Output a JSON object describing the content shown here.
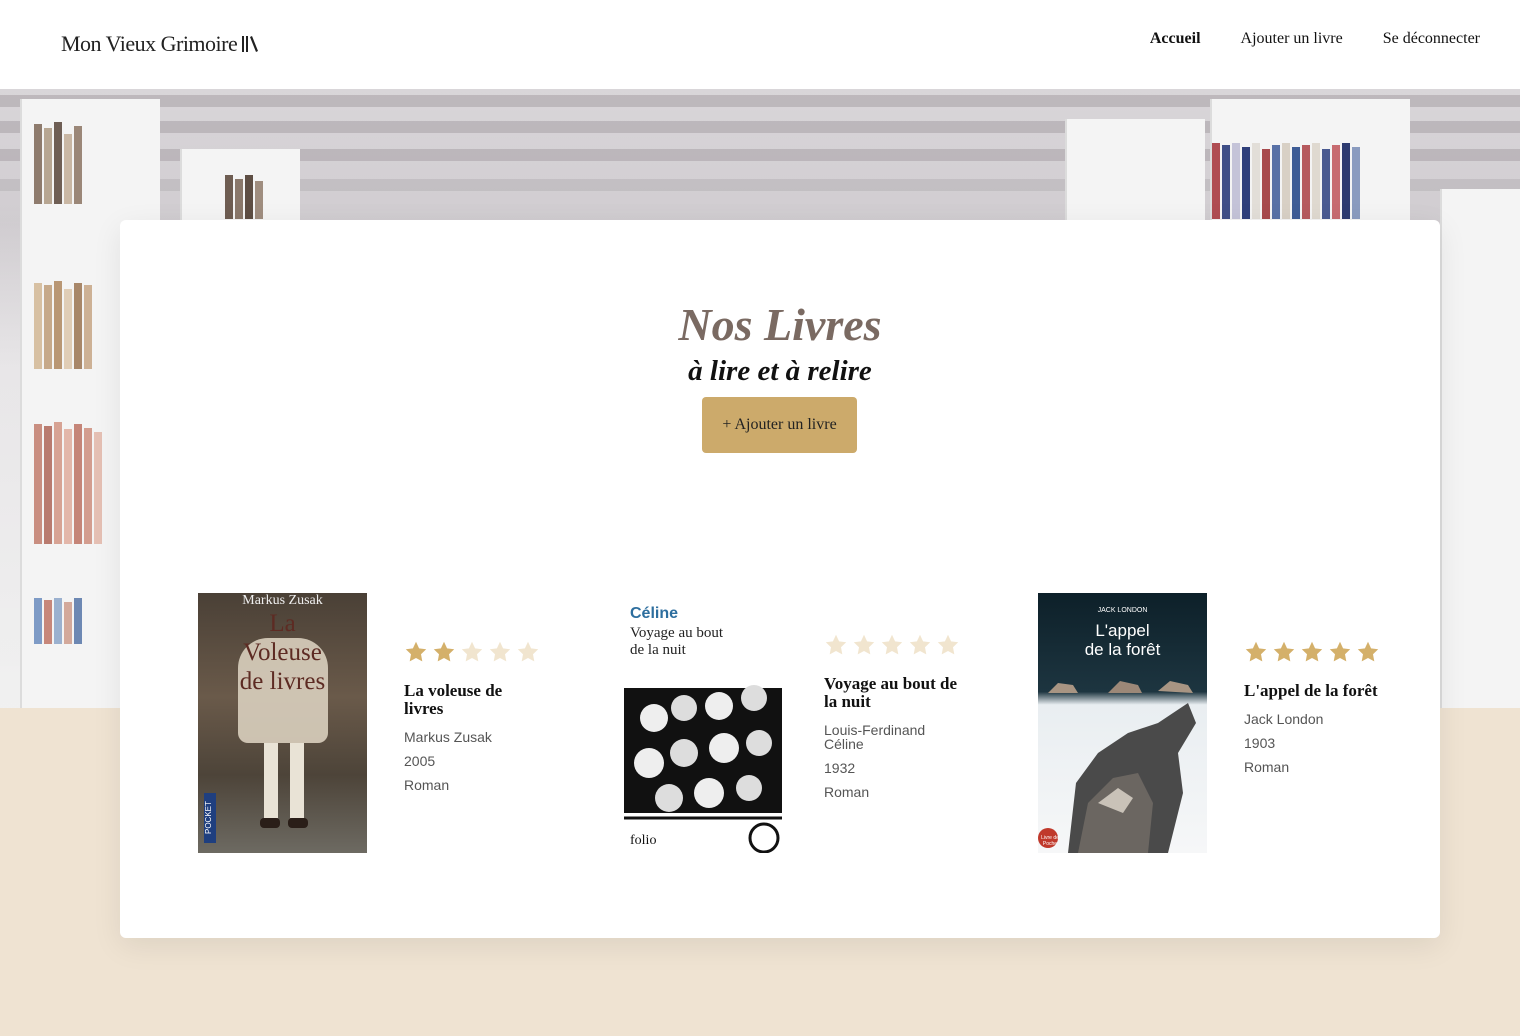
{
  "brand": {
    "name": "Mon Vieux Grimoire",
    "logo_icon": "books-icon"
  },
  "nav": [
    {
      "label": "Accueil",
      "active": true
    },
    {
      "label": "Ajouter un livre",
      "active": false
    },
    {
      "label": "Se déconnecter",
      "active": false
    }
  ],
  "hero": {
    "title": "Nos Livres",
    "subtitle": "à lire et à relire",
    "add_button": "+ Ajouter un livre"
  },
  "colors": {
    "accent": "#ccaa6b",
    "star_filled": "#d4b06a",
    "star_empty": "#f1e5cf",
    "page_bg": "#efe3d2"
  },
  "books": [
    {
      "title": "La voleuse de livres",
      "author": "Markus Zusak",
      "year": "2005",
      "genre": "Roman",
      "rating": 2,
      "cover": {
        "author": "Markus Zusak",
        "title_lines": [
          "La",
          "Voleuse",
          "de livres"
        ],
        "publisher": "POCKET"
      }
    },
    {
      "title": "Voyage au bout de la nuit",
      "author": "Louis-Ferdinand Céline",
      "year": "1932",
      "genre": "Roman",
      "rating": 0,
      "cover": {
        "author": "Céline",
        "title_lines": [
          "Voyage au bout",
          "de la nuit"
        ],
        "publisher": "folio"
      }
    },
    {
      "title": "L'appel de la forêt",
      "author": "Jack London",
      "year": "1903",
      "genre": "Roman",
      "rating": 5,
      "cover": {
        "author": "JACK LONDON",
        "title_lines": [
          "L'appel",
          "de la forêt"
        ],
        "publisher": "Livre de Poche"
      }
    }
  ]
}
